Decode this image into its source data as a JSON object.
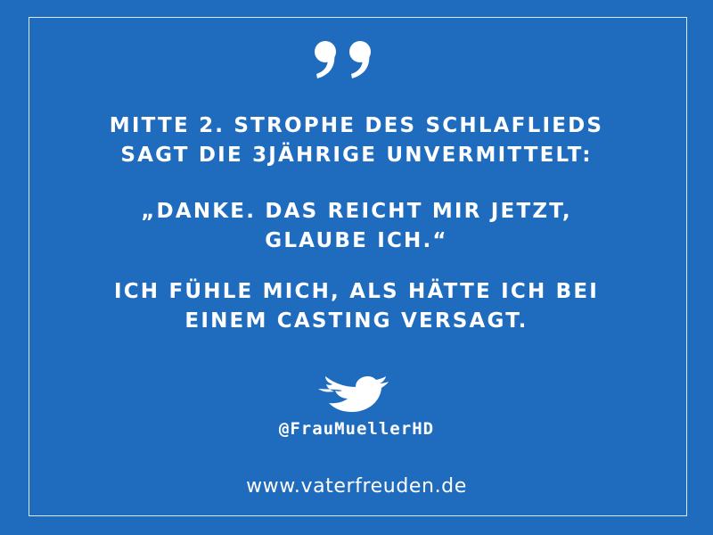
{
  "quote": {
    "paragraph1": [
      "MITTE 2. STROPHE DES SCHLAFLIEDS",
      "SAGT DIE 3JÄHRIGE UNVERMITTELT:"
    ],
    "paragraph2": [
      "„DANKE. DAS REICHT MIR JETZT,",
      "GLAUBE ICH.“"
    ],
    "paragraph3": [
      "ICH FÜHLE MICH, ALS HÄTTE ICH BEI",
      "EINEM CASTING VERSAGT."
    ]
  },
  "icons": {
    "quote_mark": "quote-mark-icon",
    "twitter": "twitter-bird-icon"
  },
  "handle": "@FrauMuellerHD",
  "website": "www.vaterfreuden.de",
  "colors": {
    "background": "#1f6cbf",
    "text": "#ffffff",
    "frame": "#ffffff"
  }
}
